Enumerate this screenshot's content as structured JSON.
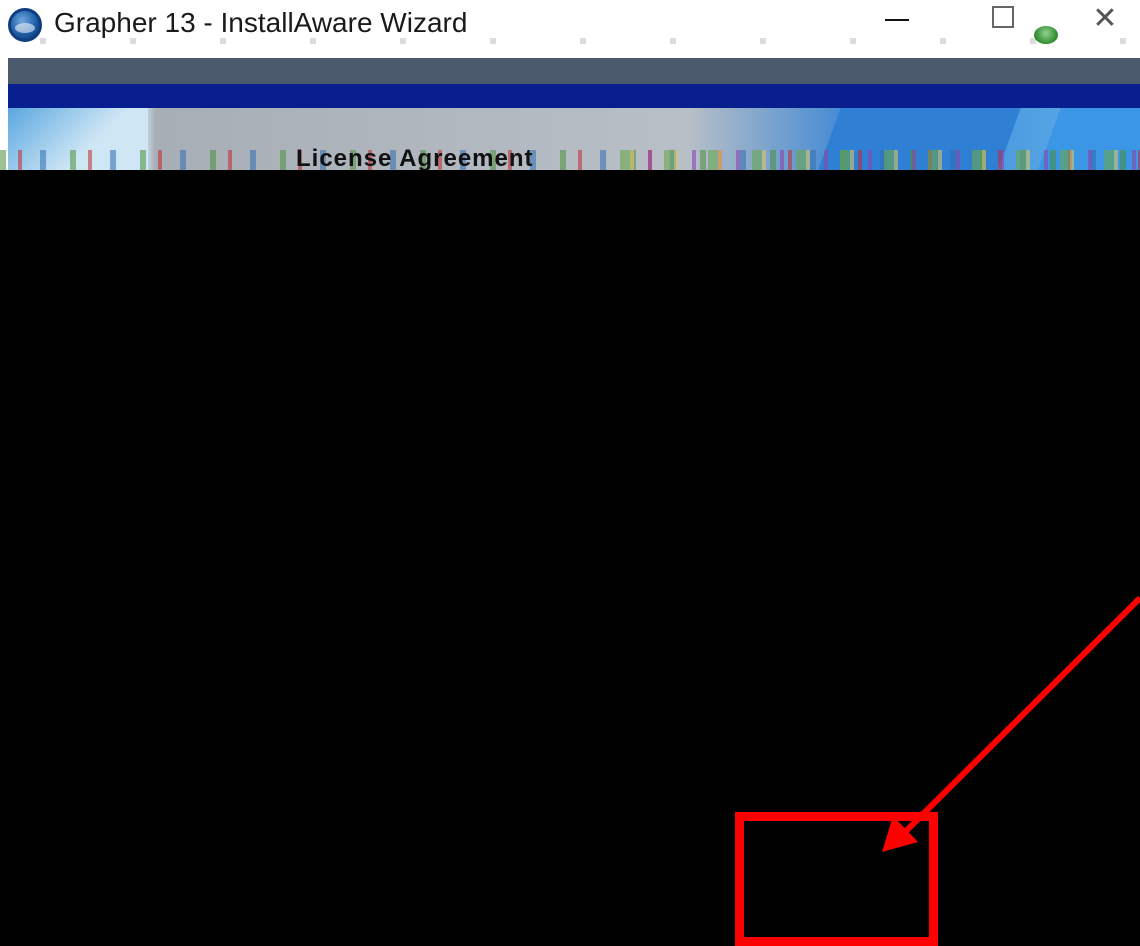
{
  "window": {
    "title": "Grapher 13 - InstallAware Wizard"
  },
  "header": {
    "title": "License Agreement"
  },
  "annotation": {
    "color": "#ff0000"
  },
  "icons": {
    "app": "grapher-globe-icon",
    "minimize": "minimize-icon",
    "maximize": "maximize-icon",
    "close": "close-icon",
    "status": "green-status-icon"
  },
  "colors": {
    "banner_gray": "#4a5a6c",
    "banner_blue": "#0a1f8f",
    "body": "#000000"
  }
}
